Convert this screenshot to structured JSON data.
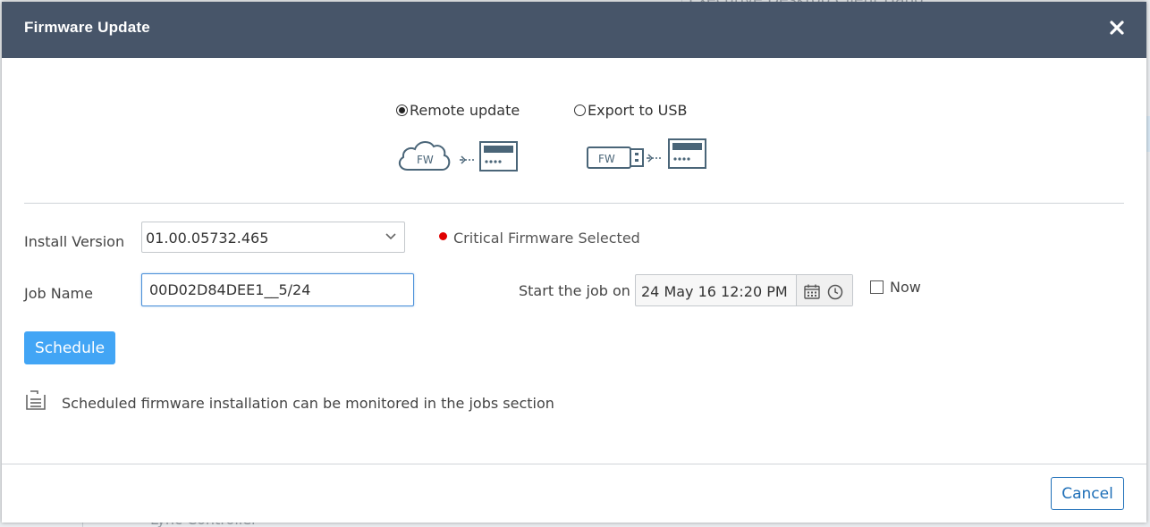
{
  "background": {
    "top_text": "Executive Desktop Client Hand",
    "bottom_text": "Lync Controller"
  },
  "modal": {
    "title": "Firmware Update",
    "close_icon": "close-icon"
  },
  "update_mode": {
    "options": [
      {
        "label": "Remote update",
        "checked": true,
        "icon": "cloud-to-device-icon",
        "art_text": "FW"
      },
      {
        "label": "Export to USB",
        "checked": false,
        "icon": "usb-to-device-icon",
        "art_text": "FW"
      }
    ]
  },
  "install_version": {
    "label": "Install Version",
    "value": "01.00.05732.465",
    "critical_text": "Critical Firmware Selected"
  },
  "job_name": {
    "label": "Job Name",
    "value": "00D02D84DEE1__5/24"
  },
  "start_job": {
    "label": "Start the job on",
    "value": "24 May 16 12:20 PM",
    "now_label": "Now",
    "now_checked": false
  },
  "actions": {
    "schedule_label": "Schedule",
    "cancel_label": "Cancel"
  },
  "info": {
    "text": "Scheduled firmware installation can be monitored in the jobs section"
  },
  "colors": {
    "header_bg": "#475569",
    "primary": "#42a5f5",
    "cancel_border": "#1e6fb8",
    "critical": "#e00000"
  }
}
